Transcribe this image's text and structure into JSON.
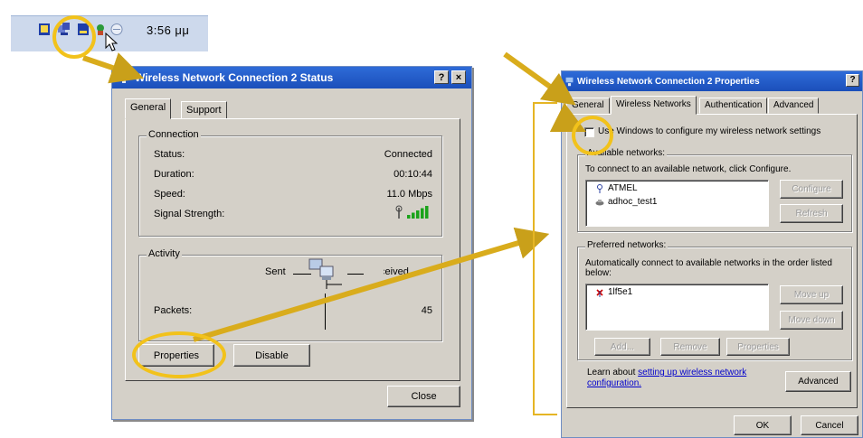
{
  "taskbar": {
    "clock": "3:56 μμ"
  },
  "status_window": {
    "title": "Wireless Network Connection 2 Status",
    "help_button": "?",
    "close_button": "×",
    "tabs": [
      {
        "label": "General",
        "active": true
      },
      {
        "label": "Support",
        "active": false
      }
    ],
    "connection": {
      "legend": "Connection",
      "rows": [
        {
          "label": "Status:",
          "value": "Connected"
        },
        {
          "label": "Duration:",
          "value": "00:10:44"
        },
        {
          "label": "Speed:",
          "value": "11.0 Mbps"
        },
        {
          "label": "Signal Strength:"
        }
      ],
      "signal_bars_filled": 5,
      "signal_bars_total": 5
    },
    "activity": {
      "legend": "Activity",
      "sent_label": "Sent",
      "received_label": "Received",
      "packets_label": "Packets:",
      "packets_sent": "",
      "packets_received": "45"
    },
    "buttons": {
      "properties": "Properties",
      "disable": "Disable",
      "close": "Close"
    }
  },
  "properties_window": {
    "title": "Wireless Network Connection 2 Properties",
    "help_button": "?",
    "close_button": "×",
    "tabs": [
      {
        "label": "General",
        "active": false
      },
      {
        "label": "Wireless Networks",
        "active": true
      },
      {
        "label": "Authentication",
        "active": false
      },
      {
        "label": "Advanced",
        "active": false
      }
    ],
    "use_windows_checkbox": {
      "label": "Use Windows to configure my wireless network settings",
      "checked": false
    },
    "available": {
      "legend": "Available networks:",
      "description": "To connect to an available network, click Configure.",
      "networks": [
        {
          "name": "ATMEL",
          "icon": "antenna-icon"
        },
        {
          "name": "adhoc_test1",
          "icon": "adhoc-icon"
        }
      ],
      "configure_button": "Configure",
      "refresh_button": "Refresh"
    },
    "preferred": {
      "legend": "Preferred networks:",
      "description_line1": "Automatically connect to available networks in the order listed",
      "description_line2": "below:",
      "networks": [
        {
          "name": "1lf5e1",
          "icon": "disconnected-antenna-icon"
        }
      ],
      "move_up_button": "Move up",
      "move_down_button": "Move down",
      "add_button": "Add...",
      "remove_button": "Remove",
      "properties_button": "Properties"
    },
    "learn": {
      "prefix": "Learn about ",
      "link_line1": "setting up wireless network",
      "link_line2": "configuration."
    },
    "advanced_button": "Advanced",
    "ok_button": "OK",
    "cancel_button": "Cancel"
  },
  "colors": {
    "annotation": "#f2c21b",
    "titlebar": "#2159c9",
    "window_face": "#d4d0c8",
    "signal_green": "#1aa31a"
  }
}
